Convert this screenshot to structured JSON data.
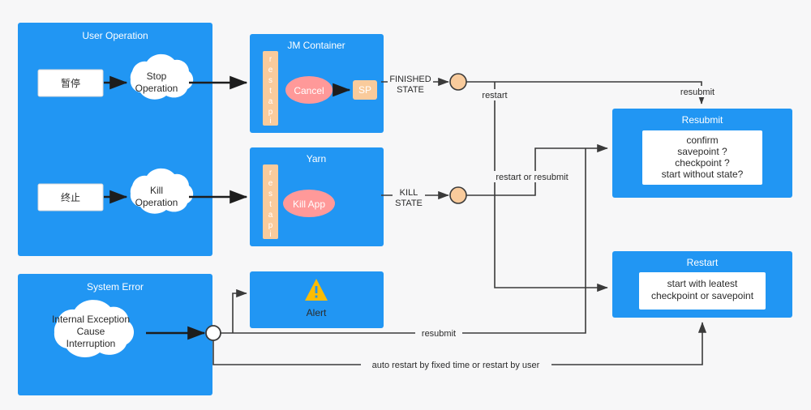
{
  "diagram": {
    "title": "Flink job stop/kill/restart state flow",
    "colors": {
      "panel_blue": "#2196f3",
      "panel_blue_light": "#2a9df4",
      "background": "#f7f7f8",
      "rest_api_orange": "#f9cb9c",
      "cancel_pink": "#f99",
      "alert_yellow": "#fbbc04",
      "junction_orange": "#f9cb9c",
      "line_dark": "#3a3a3a",
      "white": "#ffffff"
    },
    "panels": {
      "user_operation": {
        "title": "User Operation"
      },
      "jm_container": {
        "title": "JM Container"
      },
      "yarn": {
        "title": "Yarn"
      },
      "system_error": {
        "title": "System Error"
      },
      "alert": {
        "title": "Alert",
        "icon": "warning-triangle-icon"
      },
      "resubmit": {
        "title": "Resubmit",
        "body_lines": [
          "confirm",
          "savepoint ?",
          "checkpoint ?",
          "start without state?"
        ]
      },
      "restart": {
        "title": "Restart",
        "body_lines": [
          "start with leatest",
          "checkpoint or savepoint"
        ]
      }
    },
    "nodes": {
      "pause_box": {
        "label": "暂停"
      },
      "terminate_box": {
        "label": "终止"
      },
      "stop_operation": {
        "lines": [
          "Stop",
          "Operation"
        ]
      },
      "kill_operation": {
        "lines": [
          "Kill",
          "Operation"
        ]
      },
      "internal_exception": {
        "lines": [
          "Internal Exception",
          "Cause",
          "Interruption"
        ]
      },
      "rest_api_jm": {
        "label": "rest api",
        "chars": [
          "r",
          "e",
          "s",
          "t",
          "a",
          "p",
          "i"
        ]
      },
      "rest_api_yarn": {
        "label": "rest api",
        "chars": [
          "r",
          "e",
          "s",
          "t",
          "a",
          "p",
          "i"
        ]
      },
      "cancel": {
        "label": "Cancel"
      },
      "kill_app": {
        "label": "Kill App"
      },
      "savepoint": {
        "label": "SP"
      }
    },
    "edge_labels": {
      "finished_state": [
        "FINISHED",
        "STATE"
      ],
      "kill_state": [
        "KILL",
        "STATE"
      ],
      "restart": "restart",
      "restart_or_resubmit": "restart or resubmit",
      "resubmit_top": "resubmit",
      "resubmit_bottom": "resubmit",
      "auto_restart": "auto restart by fixed time or restart by user"
    }
  }
}
